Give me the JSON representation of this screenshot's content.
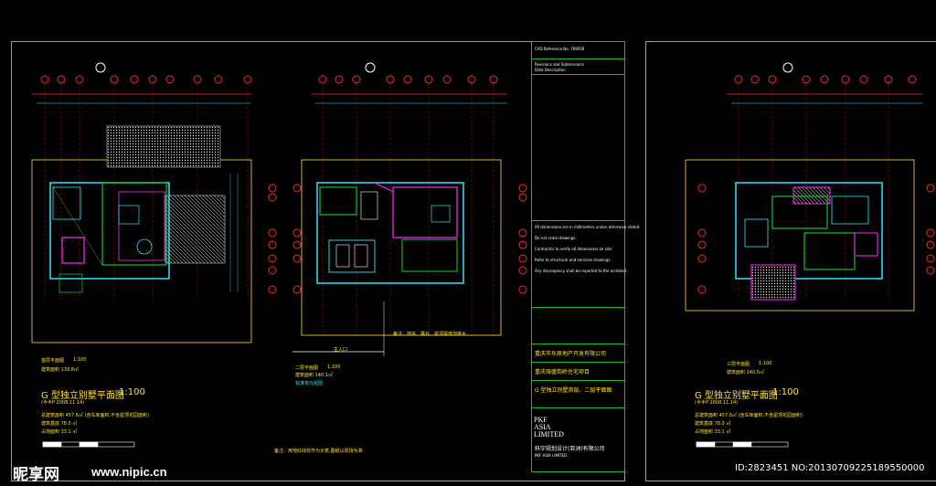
{
  "colors": {
    "background": "#000000",
    "cad_cyan": "#2fe6ff",
    "cad_yellow": "#ffe23a",
    "cad_magenta": "#ff28ff",
    "cad_green": "#16c028",
    "cad_red": "#ff2a2a",
    "cad_white": "#ffffff"
  },
  "sheet1": {
    "plan_label": "首层平面图",
    "plan_scale": "1:100",
    "plan_area": "建筑面积 139.8㎡",
    "title": "G 型独立别墅平面图",
    "title_scale": "1:100",
    "subtitle": "(半半P 2008.11.14)",
    "stat1": "总建筑面积 457.6㎡ (含车库面积,不含屋顶花园面积)",
    "stat2": "建筑基底 78.0 ㎡",
    "stat3": "占地面积 33.1 ㎡",
    "note": "备注：用地红线仅作为示意,图纸以现场为准"
  },
  "sheet2": {
    "plan_label": "二层平面图",
    "plan_scale": "1:100",
    "plan_area": "建筑面积 140.1㎡",
    "unit_label": "标准单元组团",
    "entrance_label": "主入口",
    "note": "备注：地块、露台、屋顶需增加排水"
  },
  "title_block": {
    "rows": [
      "CAD Reference No.  768P28",
      "Revisions and Submissions",
      "Date   Description",
      "重庆市东原地产开发有限公司",
      "重庆强盛韵岭住宅项目",
      "G 型独立别墅首层、二层平面图",
      "PKF ASIA LIMITED",
      "科宇规划设计(亚洲)有限公司"
    ],
    "notes": [
      "All dimensions are in millimeters unless otherwise stated.",
      "Do not scale drawings.",
      "Contractor to verify all dimensions on site.",
      "Refer to structural and services drawings.",
      "Any discrepancy shall be reported to the architect."
    ],
    "logo_lines": [
      "PKF",
      "ASIA",
      "LIMITED"
    ]
  },
  "sheet3": {
    "plan_label": "三层平面图",
    "plan_scale": "1:100",
    "plan_area": "建筑面积 140.5㎡",
    "title": "G 型独立别墅平面图",
    "title_scale": "1:100",
    "subtitle": "(半半P 2008.11.14)",
    "stat1": "总建筑面积 457.6㎡ (含车库面积,不含屋顶花园面积)",
    "stat2": "建筑基底 78.0 ㎡",
    "stat3": "占地面积 33.1 ㎡"
  },
  "watermark": {
    "brand": "昵享网",
    "site": "www.nipic.cn",
    "id": "ID:2823451 NO:20130709225189550000"
  }
}
